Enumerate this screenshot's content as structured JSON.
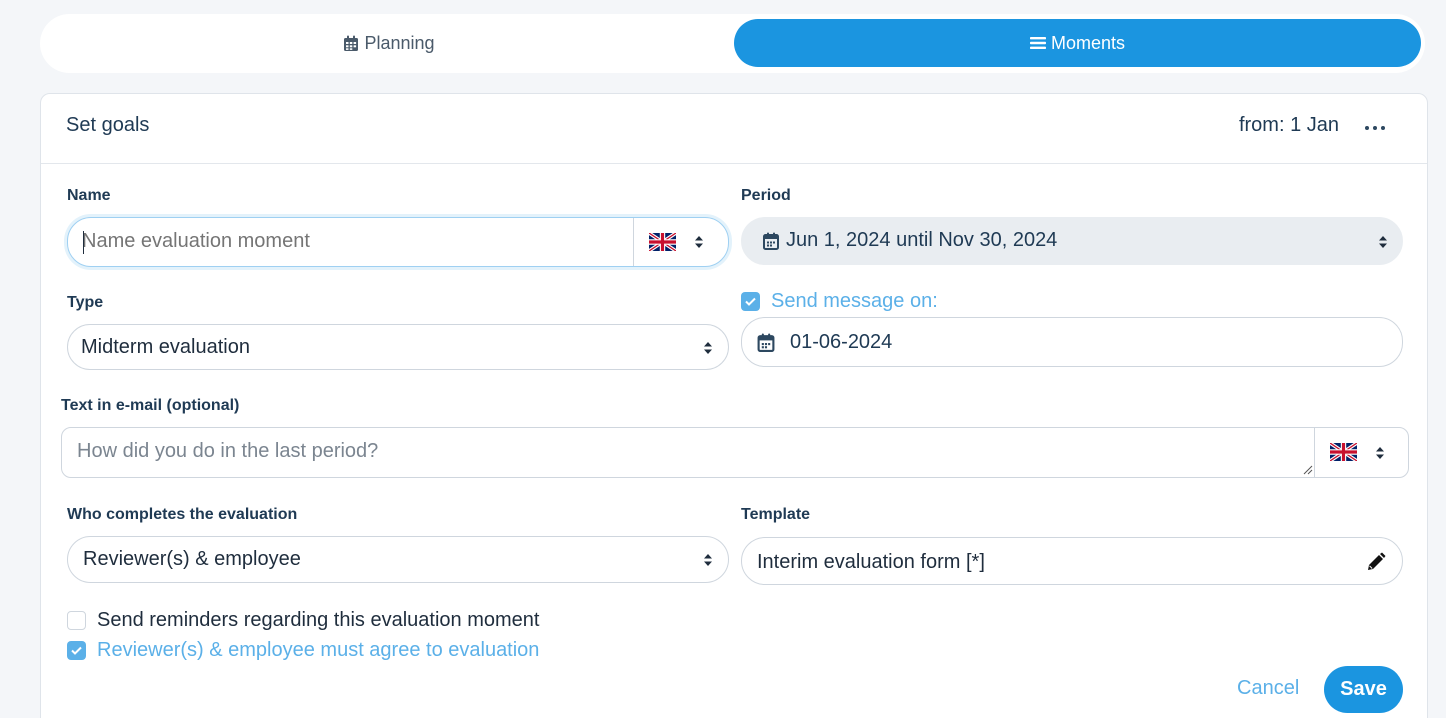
{
  "tabs": [
    {
      "label": "Planning",
      "icon": "calendar-icon",
      "active": false
    },
    {
      "label": "Moments",
      "icon": "list-icon",
      "active": true
    }
  ],
  "card": {
    "title": "Set goals",
    "from_text": "from: 1 Jan",
    "more_icon": "ellipsis-icon"
  },
  "form": {
    "name": {
      "label": "Name",
      "placeholder": "Name evaluation moment",
      "value": "",
      "language_flag": "uk-flag-icon"
    },
    "period": {
      "label": "Period",
      "value": "Jun 1, 2024 until Nov 30, 2024"
    },
    "type": {
      "label": "Type",
      "value": "Midterm evaluation"
    },
    "send_message": {
      "label": "Send message on:",
      "checked": true,
      "date": "01-06-2024"
    },
    "email_text": {
      "label": "Text in e-mail (optional)",
      "placeholder": "How did you do in the last period?",
      "language_flag": "uk-flag-icon"
    },
    "completed_by": {
      "label": "Who completes the evaluation",
      "value": "Reviewer(s) & employee"
    },
    "template": {
      "label": "Template",
      "value": "Interim evaluation form [*]",
      "edit_icon": "pencil-icon"
    },
    "reminders": {
      "label": "Send reminders regarding this evaluation moment",
      "checked": false
    },
    "must_agree": {
      "label": "Reviewer(s) & employee must agree to evaluation",
      "checked": true
    }
  },
  "actions": {
    "cancel_label": "Cancel",
    "save_label": "Save"
  },
  "colors": {
    "primary": "#1b95e0",
    "accent_light": "#5bb0e8",
    "text_dark": "#1f3a54",
    "period_bg": "#e9edf1"
  }
}
